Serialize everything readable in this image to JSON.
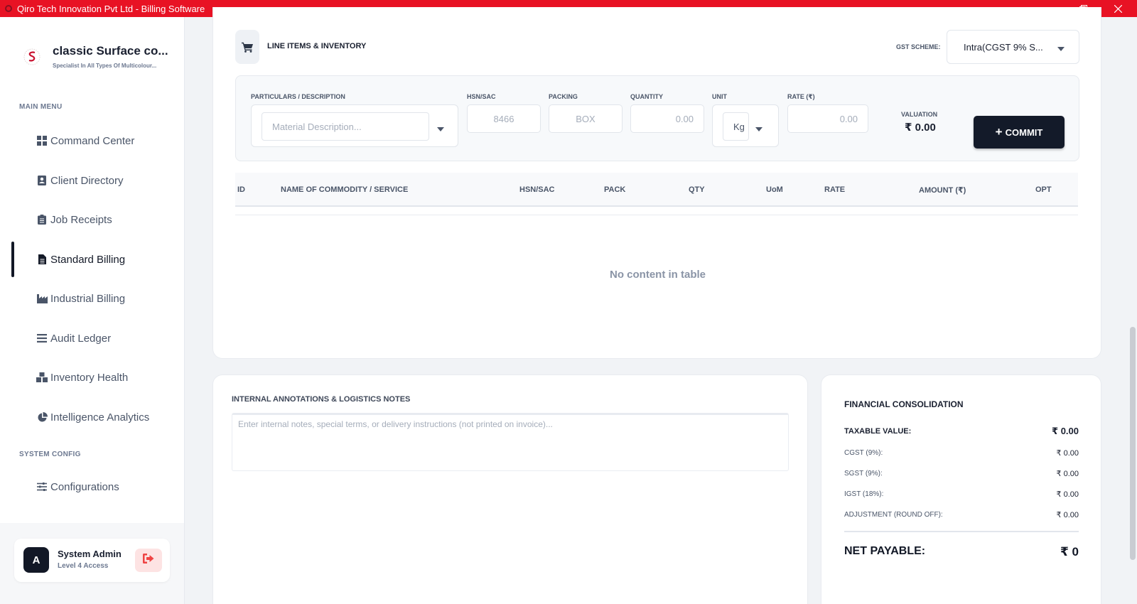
{
  "window": {
    "title": "Qiro Tech Innovation Pvt Ltd - Billing Software"
  },
  "brand": {
    "name": "classic Surface co...",
    "tagline": "Specialist In All Types Of Multicolour..."
  },
  "sidebar": {
    "main_menu_label": "MAIN MENU",
    "items": [
      {
        "label": "Command Center",
        "icon": "grid-icon"
      },
      {
        "label": "Client Directory",
        "icon": "contact-card-icon"
      },
      {
        "label": "Job Receipts",
        "icon": "clipboard-icon"
      },
      {
        "label": "Standard Billing",
        "icon": "document-icon",
        "active": true
      },
      {
        "label": "Industrial Billing",
        "icon": "factory-icon"
      },
      {
        "label": "Audit Ledger",
        "icon": "list-icon"
      },
      {
        "label": "Inventory Health",
        "icon": "boxes-icon"
      },
      {
        "label": "Intelligence Analytics",
        "icon": "pie-chart-icon"
      }
    ],
    "system_config_label": "SYSTEM CONFIG",
    "config_items": [
      {
        "label": "Configurations",
        "icon": "sliders-icon"
      }
    ]
  },
  "user": {
    "initial": "A",
    "name": "System Admin",
    "level": "Level 4 Access"
  },
  "line_items": {
    "title": "LINE ITEMS & INVENTORY",
    "gst_label": "GST SCHEME:",
    "gst_value": "Intra(CGST 9% S...",
    "fields": {
      "particulars_label": "PARTICULARS / DESCRIPTION",
      "particulars_placeholder": "Material Description...",
      "hsn_label": "HSN/SAC",
      "hsn_value": "8466",
      "packing_label": "PACKING",
      "packing_value": "BOX",
      "quantity_label": "QUANTITY",
      "quantity_value": "0.00",
      "unit_label": "UNIT",
      "unit_value": "Kg",
      "rate_label": "RATE (₹)",
      "rate_value": "0.00",
      "valuation_label": "VALUATION",
      "valuation_value": "₹ 0.00"
    },
    "commit_label": "COMMIT",
    "table": {
      "columns": [
        "ID",
        "NAME OF COMMODITY / SERVICE",
        "HSN/SAC",
        "PACK",
        "QTY",
        "UoM",
        "RATE",
        "AMOUNT (₹)",
        "OPT"
      ],
      "empty_message": "No content in table"
    }
  },
  "notes": {
    "title": "INTERNAL ANNOTATIONS & LOGISTICS NOTES",
    "placeholder": "Enter internal notes, special terms, or delivery instructions (not printed on invoice)..."
  },
  "financial": {
    "title": "FINANCIAL CONSOLIDATION",
    "taxable_label": "TAXABLE VALUE:",
    "taxable_value": "₹ 0.00",
    "rows": [
      {
        "label": "CGST (9%):",
        "value": "₹ 0.00"
      },
      {
        "label": "SGST (9%):",
        "value": "₹ 0.00"
      },
      {
        "label": "IGST (18%):",
        "value": "₹ 0.00"
      },
      {
        "label": "ADJUSTMENT (ROUND OFF):",
        "value": "₹ 0.00"
      }
    ],
    "net_label": "NET PAYABLE:",
    "net_value": "₹ 0"
  },
  "colors": {
    "titlebar": "#e81224",
    "accent_dark": "#131a29",
    "logout_bg": "#fde3e3"
  }
}
